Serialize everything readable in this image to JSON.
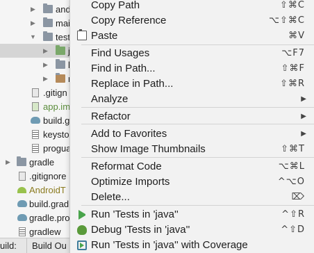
{
  "project_tree": {
    "rows": [
      {
        "label": "and",
        "kind": "folder",
        "expanded": false
      },
      {
        "label": "mai",
        "kind": "folder",
        "expanded": false
      },
      {
        "label": "test",
        "kind": "folder",
        "expanded": true
      },
      {
        "label": "j",
        "kind": "folder-green",
        "expanded": false,
        "selected": true
      },
      {
        "label": "l",
        "kind": "folder",
        "expanded": false
      },
      {
        "label": "r",
        "kind": "folder-res",
        "expanded": false
      },
      {
        "label": ".gitign",
        "kind": "file"
      },
      {
        "label": "app.im",
        "kind": "file-module"
      },
      {
        "label": "build.g",
        "kind": "gradle"
      },
      {
        "label": "keysto",
        "kind": "file-lines"
      },
      {
        "label": "progua",
        "kind": "file-lines"
      },
      {
        "label": "gradle",
        "kind": "folder",
        "expanded": false
      },
      {
        "label": ".gitignore",
        "kind": "file"
      },
      {
        "label": "AndroidT",
        "kind": "android"
      },
      {
        "label": "build.grad",
        "kind": "gradle"
      },
      {
        "label": "gradle.pro",
        "kind": "gradle"
      },
      {
        "label": "gradlew",
        "kind": "file-lines"
      }
    ]
  },
  "bottom_bar": {
    "left_label": "uild:",
    "tab_label": "Build Ou"
  },
  "context_menu": {
    "items": [
      {
        "label": "Copy Path",
        "shortcut": "⇧⌘C"
      },
      {
        "label": "Copy Reference",
        "shortcut": "⌥⇧⌘C"
      },
      {
        "label": "Paste",
        "shortcut": "⌘V",
        "icon": "paste-icon"
      },
      {
        "label": "Find Usages",
        "shortcut": "⌥F7"
      },
      {
        "label": "Find in Path...",
        "shortcut": "⇧⌘F"
      },
      {
        "label": "Replace in Path...",
        "shortcut": "⇧⌘R"
      },
      {
        "label": "Analyze",
        "submenu": true
      },
      {
        "label": "Refactor",
        "submenu": true
      },
      {
        "label": "Add to Favorites",
        "submenu": true
      },
      {
        "label": "Show Image Thumbnails",
        "shortcut": "⇧⌘T"
      },
      {
        "label": "Reformat Code",
        "shortcut": "⌥⌘L"
      },
      {
        "label": "Optimize Imports",
        "shortcut": "^⌥O"
      },
      {
        "label": "Delete...",
        "shortcut": "⌦"
      },
      {
        "label": "Run 'Tests in 'java''",
        "shortcut": "^⇧R",
        "icon": "run-icon"
      },
      {
        "label": "Debug 'Tests in 'java''",
        "shortcut": "^⇧D",
        "icon": "debug-icon"
      },
      {
        "label": "Run 'Tests in 'java'' with Coverage",
        "shortcut": "",
        "icon": "coverage-icon"
      }
    ]
  },
  "colors": {
    "menu_bg": "#f2f2f2",
    "selection_bg": "#d5d5d5",
    "run_green": "#49a44b",
    "module_green": "#5a8c3a"
  }
}
